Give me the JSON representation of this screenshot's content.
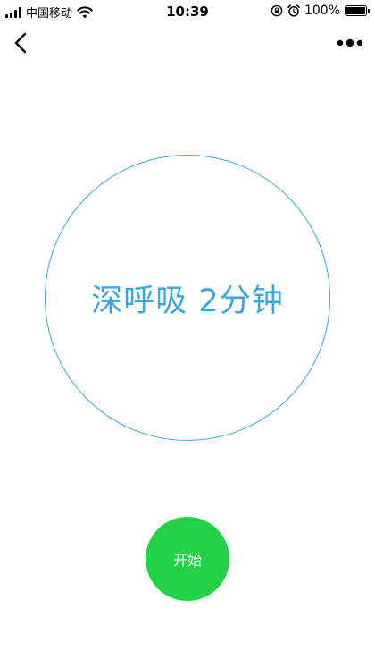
{
  "status_bar": {
    "carrier": "中国移动",
    "time": "10:39",
    "battery": "100%",
    "icons": [
      "signal-icon",
      "wifi-icon",
      "orientation-lock-icon",
      "alarm-icon",
      "battery-icon"
    ]
  },
  "nav": {
    "back_icon": "chevron-left-icon",
    "more_icon": "more-dots-icon"
  },
  "exercise": {
    "label": "深呼吸 2分钟"
  },
  "start_button": {
    "label": "开始"
  },
  "colors": {
    "accent": "#3aa6dd",
    "start_button": "#21d146",
    "background": "#ffffff"
  }
}
